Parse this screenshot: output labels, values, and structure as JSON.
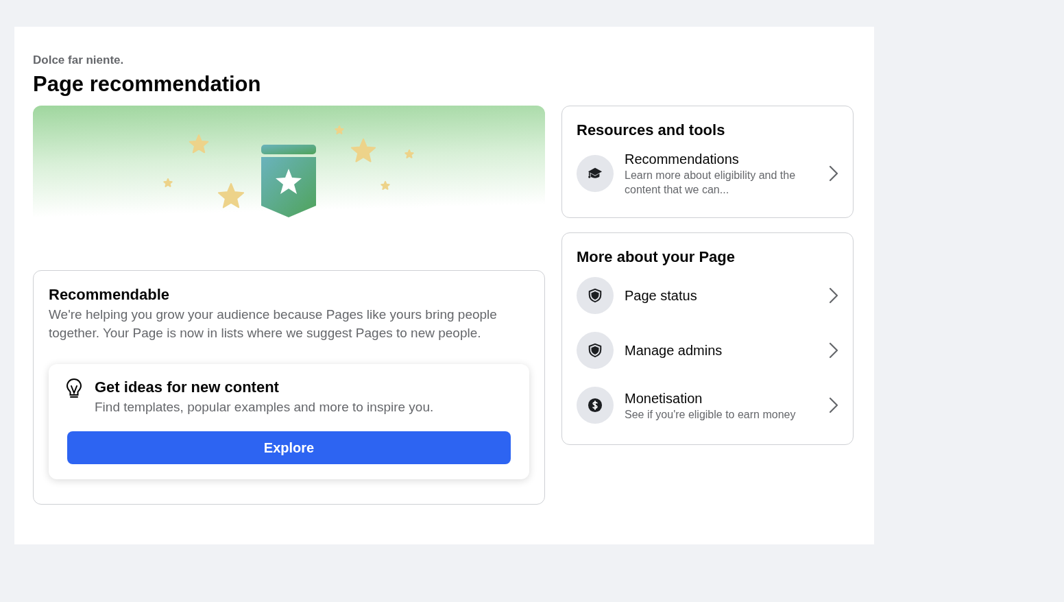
{
  "header": {
    "eyebrow": "Dolce far niente.",
    "title": "Page recommendation"
  },
  "status_card": {
    "title": "Recommendable",
    "body": "We're helping you grow your audience because Pages like yours bring people together. Your Page is now in lists where we suggest Pages to new people.",
    "ideas": {
      "title": "Get ideas for new content",
      "body": "Find templates, popular examples and more to inspire you.",
      "button": "Explore"
    }
  },
  "sections": [
    {
      "title": "Resources and tools",
      "items": [
        {
          "label": "Recommendations",
          "description": "Learn more about eligibility and the content that we can..."
        }
      ]
    },
    {
      "title": "More about your Page",
      "items": [
        {
          "label": "Page status"
        },
        {
          "label": "Manage admins"
        },
        {
          "label": "Monetisation",
          "description": "See if you're eligible to earn money"
        }
      ]
    }
  ]
}
